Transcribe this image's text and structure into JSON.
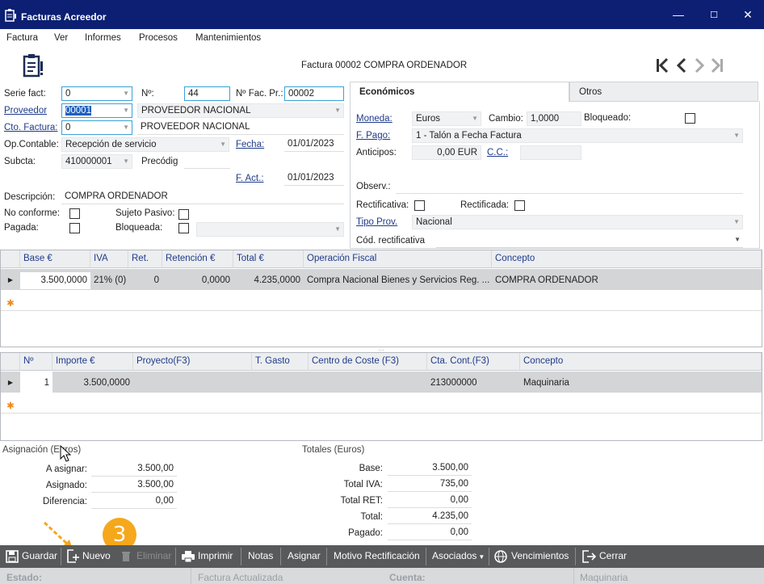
{
  "window": {
    "title": "Facturas Acreedor",
    "minimize": "—",
    "maximize": "☐",
    "close": "✕"
  },
  "menu": [
    "Factura",
    "Ver",
    "Informes",
    "Procesos",
    "Mantenimientos"
  ],
  "header": {
    "caption": "Factura 00002 COMPRA ORDENADOR"
  },
  "form": {
    "serie_label": "Serie fact:",
    "serie_value": "0",
    "numero_label": "Nº:",
    "numero_value": "44",
    "nfac_label": "Nº Fac. Pr.:",
    "nfac_value": "00002",
    "proveedor_label": "Proveedor",
    "proveedor_value": "00001",
    "proveedor_name": "PROVEEDOR NACIONAL",
    "cto_label": "Cto. Factura:",
    "cto_value": "0",
    "cto_name": "PROVEEDOR NACIONAL",
    "opcont_label": "Op.Contable:",
    "opcont_value": "Recepción de servicio",
    "fecha_label": "Fecha:",
    "fecha_value": "01/01/2023",
    "subcta_label": "Subcta:",
    "subcta_value": "410000001",
    "precodig_label": "Precódig",
    "fact_label": "F. Act.:",
    "fact_value": "01/01/2023",
    "desc_label": "Descripción:",
    "desc_value": "COMPRA ORDENADOR",
    "noconf_label": "No conforme:",
    "sujeto_label": "Sujeto Pasivo:",
    "pagada_label": "Pagada:",
    "bloqueada_label": "Bloqueada:"
  },
  "tabs": {
    "economicos": "Económicos",
    "otros": "Otros"
  },
  "econ": {
    "moneda_label": "Moneda:",
    "moneda_value": "Euros",
    "cambio_label": "Cambio:",
    "cambio_value": "1,0000",
    "bloq_label": "Bloqueado:",
    "fpago_label": "F. Pago:",
    "fpago_value": "1 - Talón a Fecha Factura",
    "anticipos_label": "Anticipos:",
    "anticipos_value": "0,00 EUR",
    "cc_label": "C.C.:",
    "observ_label": "Observ.:",
    "rectificativa_label": "Rectificativa:",
    "rectificada_label": "Rectificada:",
    "tipoprov_label": "Tipo Prov.",
    "tipoprov_value": "Nacional",
    "codrect_label": "Cód. rectificativa"
  },
  "grid1": {
    "headers": [
      "Base €",
      "IVA",
      "Ret.",
      "Retención €",
      "Total €",
      "Operación Fiscal",
      "Concepto"
    ],
    "row": [
      "3.500,0000",
      "21% (0)",
      "0",
      "0,0000",
      "4.235,0000",
      "Compra Nacional Bienes y Servicios Reg. ...",
      "COMPRA ORDENADOR"
    ]
  },
  "grid2": {
    "headers": [
      "Nº",
      "Importe €",
      "Proyecto(F3)",
      "T. Gasto",
      "Centro de Coste (F3)",
      "Cta. Cont.(F3)",
      "Concepto"
    ],
    "row": [
      "1",
      "3.500,0000",
      "",
      "",
      "",
      "213000000",
      "Maquinaria"
    ]
  },
  "asignacion": {
    "title": "Asignación (Euros)",
    "a_asignar_label": "A asignar:",
    "a_asignar": "3.500,00",
    "asignado_label": "Asignado:",
    "asignado": "3.500,00",
    "diferencia_label": "Diferencia:",
    "diferencia": "0,00"
  },
  "totales": {
    "title": "Totales (Euros)",
    "base_label": "Base:",
    "base": "3.500,00",
    "iva_label": "Total IVA:",
    "iva": "735,00",
    "ret_label": "Total RET:",
    "ret": "0,00",
    "total_label": "Total:",
    "total": "4.235,00",
    "pagado_label": "Pagado:",
    "pagado": "0,00"
  },
  "step_badge": "3",
  "toolbar": {
    "guardar": "Guardar",
    "nuevo": "Nuevo",
    "eliminar": "Eliminar",
    "imprimir": "Imprimir",
    "notas": "Notas",
    "asignar": "Asignar",
    "motivo": "Motivo Rectificación",
    "asociados": "Asociados",
    "vencimientos": "Vencimientos",
    "cerrar": "Cerrar"
  },
  "status": {
    "estado_label": "Estado:",
    "estado_value": "Factura Actualizada",
    "cuenta_label": "Cuenta:",
    "cuenta_value": "Maquinaria"
  },
  "colors": {
    "titlebar": "#0c1f73",
    "toolbar": "#58595b",
    "badge": "#f5a81c",
    "accent": "#3aa2d7"
  }
}
